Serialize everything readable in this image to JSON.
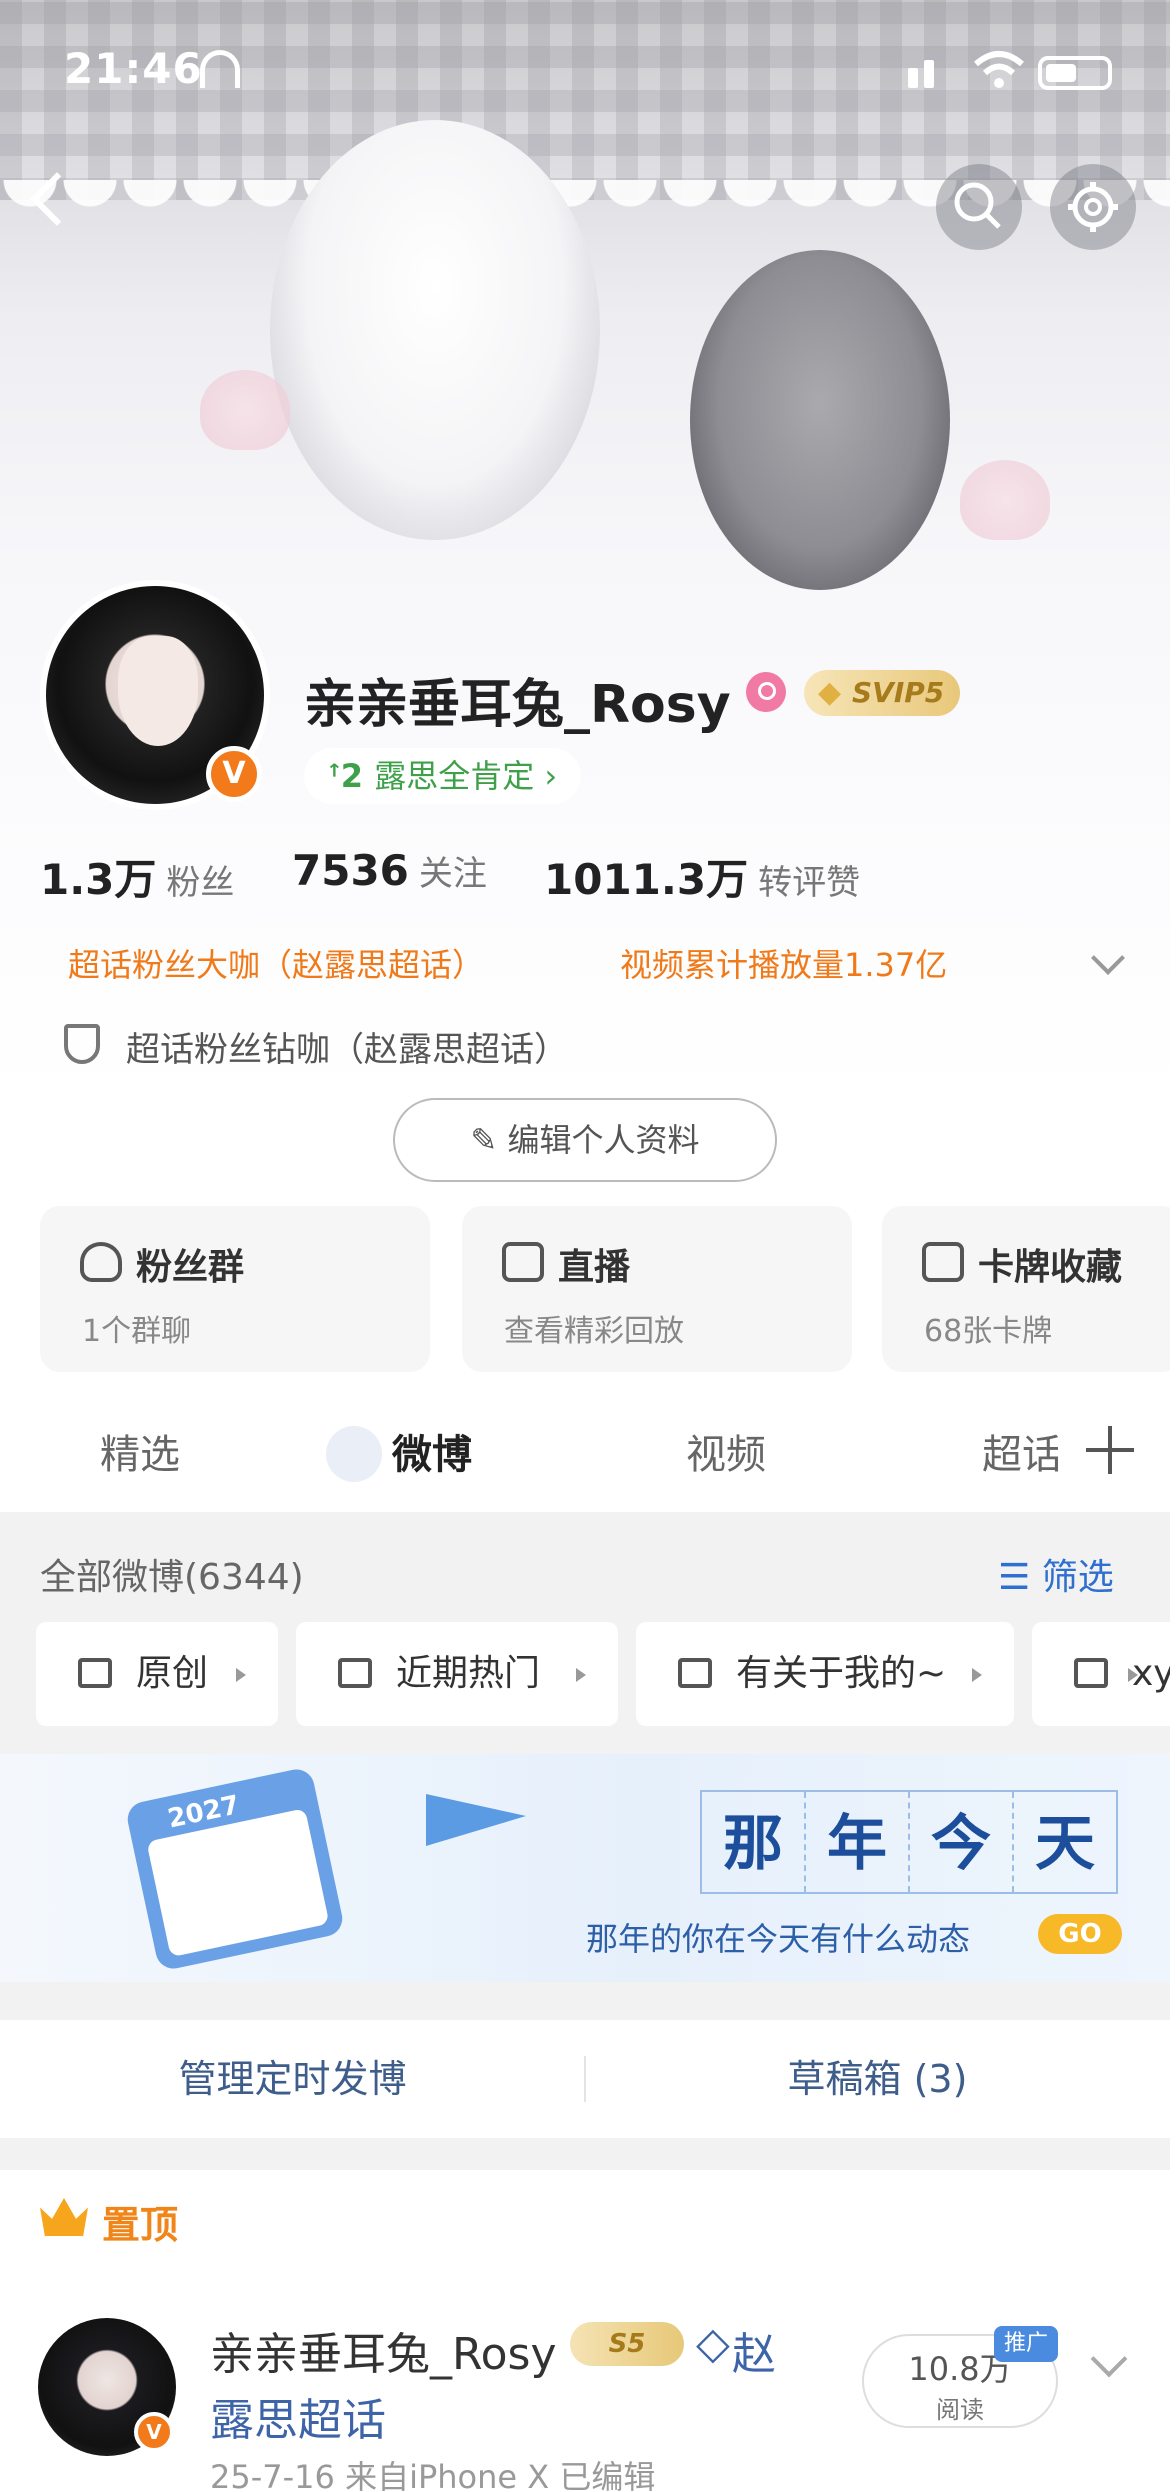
{
  "status": {
    "time": "21:46"
  },
  "profile": {
    "name": "亲亲垂耳兔_Rosy",
    "vip": "SVIP5",
    "tag": "露思全肯定",
    "followers": {
      "value": "1.3万",
      "label": "粉丝"
    },
    "following": {
      "value": "7536",
      "label": "关注"
    },
    "likes": {
      "value": "1011.3万",
      "label": "转评赞"
    },
    "achievements": [
      "超话粉丝大咖（赵露思超话）",
      "视频累计播放量1.37亿"
    ],
    "fan_level": "超话粉丝钻咖（赵露思超话）",
    "edit_label": "编辑个人资料"
  },
  "cards": [
    {
      "title": "粉丝群",
      "subtitle": "1个群聊"
    },
    {
      "title": "直播",
      "subtitle": "查看精彩回放"
    },
    {
      "title": "卡牌收藏",
      "subtitle": "68张卡牌"
    }
  ],
  "tabs": [
    "精选",
    "微博",
    "视频",
    "超话"
  ],
  "feed": {
    "all_label": "全部微博",
    "all_count": "(6344)",
    "filter_label": "筛选",
    "chips": [
      "原创",
      "近期热门",
      "有关于我的~",
      "xy"
    ]
  },
  "promo": {
    "chars": [
      "那",
      "年",
      "今",
      "天"
    ],
    "subtitle": "那年的你在今天有什么动态",
    "go": "GO",
    "calendar_year": "2027"
  },
  "actions": {
    "scheduled": "管理定时发博",
    "drafts": "草稿箱 (3)"
  },
  "pinned": {
    "label": "置顶",
    "name": "亲亲垂耳兔_Rosy",
    "vip": "S5",
    "topic": "赵露思超话",
    "reads_value": "10.8万",
    "reads_label": "阅读",
    "promo_tag": "推广",
    "meta": "25-7-16  来自iPhone X  已编辑"
  },
  "colors": {
    "accent_orange": "#f07a1a",
    "link_blue": "#2f6fcf",
    "green_tag": "#3fa04a"
  }
}
